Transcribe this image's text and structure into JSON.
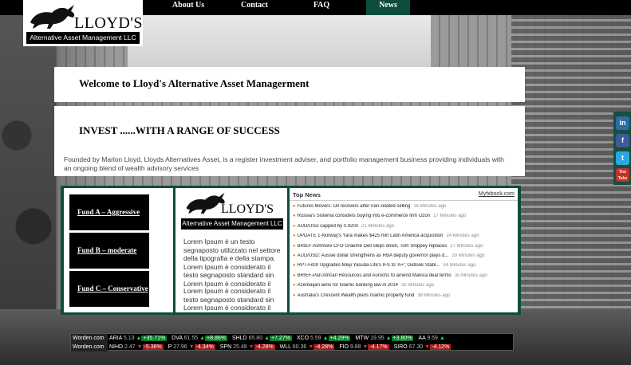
{
  "nav": {
    "items": [
      {
        "label": "About Us",
        "active": false
      },
      {
        "label": "Contact",
        "active": false
      },
      {
        "label": "FAQ",
        "active": false
      },
      {
        "label": "News",
        "active": true
      }
    ],
    "active_color": "#0e4d3c"
  },
  "logo": {
    "name": "LLOYD'S",
    "tagline": "Alternative Asset Management LLC"
  },
  "welcome": {
    "title": "Welcome to Lloyd's Alternative Asset Managerment"
  },
  "intro": {
    "heading": "INVEST ......WITH A RANGE OF SUCCESS",
    "text": "Founded by Marlon Lloyd, Lloyds Alternatives Asset, is a register investment adviser, and portfolio management business providing individuals with an ongoing blend of wealth advisory services"
  },
  "social": [
    {
      "icon": "linkedin-icon",
      "glyph": "in",
      "color": "#2a6ea6"
    },
    {
      "icon": "facebook-icon",
      "glyph": "f",
      "color": "#3b5b9a"
    },
    {
      "icon": "twitter-icon",
      "glyph": "t",
      "color": "#2aa8e0"
    },
    {
      "icon": "youtube-icon",
      "glyph": "You Tube",
      "color": "#c4302b"
    }
  ],
  "funds": [
    {
      "label": "Fund A – Aggressive"
    },
    {
      "label": "Fund B – moderate"
    },
    {
      "label": "Fund C – Conservative"
    }
  ],
  "about": {
    "paragraph_1": "Lorem Ipsum è un testo segnaposto utilizzato nel settore della tipografia e della stampa. Lorem Ipsum è considerato il testo segnaposto standard sin Lorem Ipsum è considerato il",
    "paragraph_2": "Lorem Ipsum è considerato il testo segnaposto standard sin Lorem Ipsum è considerato il"
  },
  "news": {
    "title": "Top News",
    "source": "Myfxbook.com",
    "items": [
      {
        "text": "Futures Movers: Oil recovers after Iran-related selling",
        "ago": "16 Minutes ago"
      },
      {
        "text": "Russia's Sistema considers buying into e-commerce firm Ozon",
        "ago": "17 Minutes ago"
      },
      {
        "text": "AUD/USD capped by 0.9200",
        "ago": "21 Minutes ago"
      },
      {
        "text": "UPDATE 1-Norway's Yara makes $425 mln Latin America acquisition",
        "ago": "24 Minutes ago"
      },
      {
        "text": "BRIEF-Ashmore CFO Graeme Dell steps down, Tom Shippey replaces",
        "ago": "27 Minutes ago"
      },
      {
        "text": "AUD/USD: Aussie dollar strengthens as RBA deputy governor plays d...",
        "ago": "29 Minutes ago"
      },
      {
        "text": "RPT-Fitch Upgrades Meiji Yasuda Life's IFS to 'A+'; Outlook Stabl...",
        "ago": "34 Minutes ago"
      },
      {
        "text": "BRIEF-Pan African Resources and Aurochs to amend Manica deal terms",
        "ago": "35 Minutes ago"
      },
      {
        "text": "Azerbaijan aims for Islamic banking law in 2014",
        "ago": "35 Minutes ago"
      },
      {
        "text": "Australia's Crescent Wealth plans Islamic property fund",
        "ago": "38 Minutes ago"
      }
    ]
  },
  "ticker": {
    "brand": "Worden.com",
    "row1": [
      {
        "sym": "ARIA",
        "px": "5.13",
        "chg": "+35.71%",
        "dir": "up"
      },
      {
        "sym": "DVA",
        "px": "61.55",
        "chg": "+8.86%",
        "dir": "up"
      },
      {
        "sym": "SHLD",
        "px": "65.80",
        "chg": "+7.27%",
        "dir": "up"
      },
      {
        "sym": "XCO",
        "px": "5.59",
        "chg": "+4.29%",
        "dir": "up"
      },
      {
        "sym": "MTW",
        "px": "19.95",
        "chg": "+3.80%",
        "dir": "up"
      },
      {
        "sym": "AA",
        "px": "9.59",
        "chg": "",
        "dir": "up"
      }
    ],
    "row2": [
      {
        "sym": "NIHD",
        "px": "2.47",
        "chg": "-5.36%",
        "dir": "dn"
      },
      {
        "sym": "P",
        "px": "27.96",
        "chg": "-4.34%",
        "dir": "dn"
      },
      {
        "sym": "SPN",
        "px": "25.48",
        "chg": "-4.28%",
        "dir": "dn"
      },
      {
        "sym": "WLL",
        "px": "60.36",
        "chg": "-4.28%",
        "dir": "dn"
      },
      {
        "sym": "FIO",
        "px": "9.88",
        "chg": "-4.17%",
        "dir": "dn"
      },
      {
        "sym": "SIRO",
        "px": "67.30",
        "chg": "-4.12%",
        "dir": "dn"
      }
    ]
  }
}
